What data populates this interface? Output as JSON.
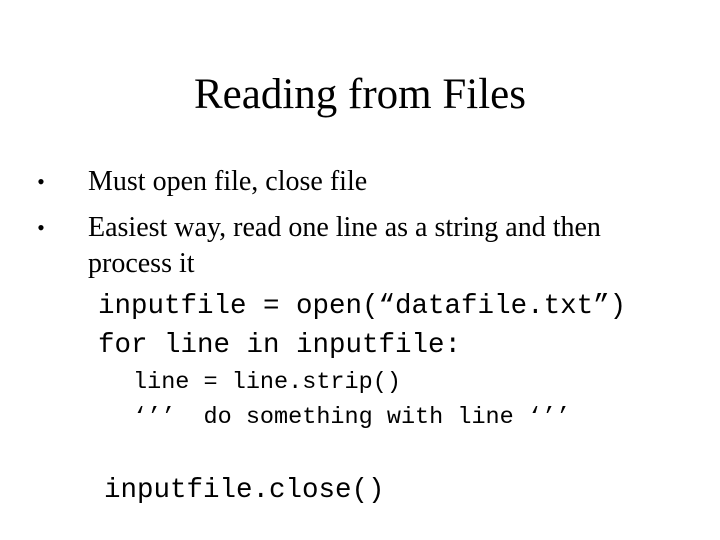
{
  "slide": {
    "title": "Reading from Files",
    "bullets": [
      {
        "glyph": "•",
        "text": "Must open file, close file"
      },
      {
        "glyph": "•",
        "text": "Easiest way, read one line as a string and then process  it"
      }
    ],
    "code": {
      "open_line": "inputfile = open(“datafile.txt”)",
      "for_line": "for line in inputfile:",
      "strip_line": "line = line.strip()",
      "comment_line": "‘’’  do something with line ‘’’",
      "close_line": "inputfile.close()"
    }
  }
}
